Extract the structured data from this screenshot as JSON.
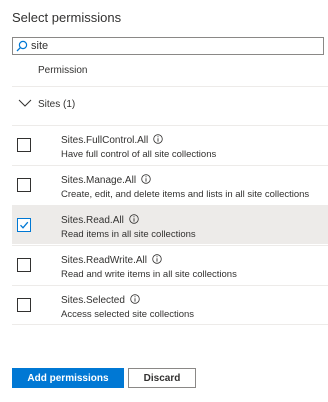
{
  "title": "Select permissions",
  "search": {
    "value": "site",
    "icon": "search-icon"
  },
  "column_header": "Permission",
  "group": {
    "label": "Sites (1)",
    "expanded": true
  },
  "permissions": [
    {
      "name": "Sites.FullControl.All",
      "description": "Have full control of all site collections",
      "checked": false
    },
    {
      "name": "Sites.Manage.All",
      "description": "Create, edit, and delete items and lists in all site collections",
      "checked": false
    },
    {
      "name": "Sites.Read.All",
      "description": "Read items in all site collections",
      "checked": true
    },
    {
      "name": "Sites.ReadWrite.All",
      "description": "Read and write items in all site collections",
      "checked": false
    },
    {
      "name": "Sites.Selected",
      "description": "Access selected site collections",
      "checked": false
    }
  ],
  "buttons": {
    "add_label": "Add permissions",
    "discard_label": "Discard"
  },
  "colors": {
    "accent": "#0078d4",
    "selected_row": "#edebe9",
    "text": "#323130"
  }
}
